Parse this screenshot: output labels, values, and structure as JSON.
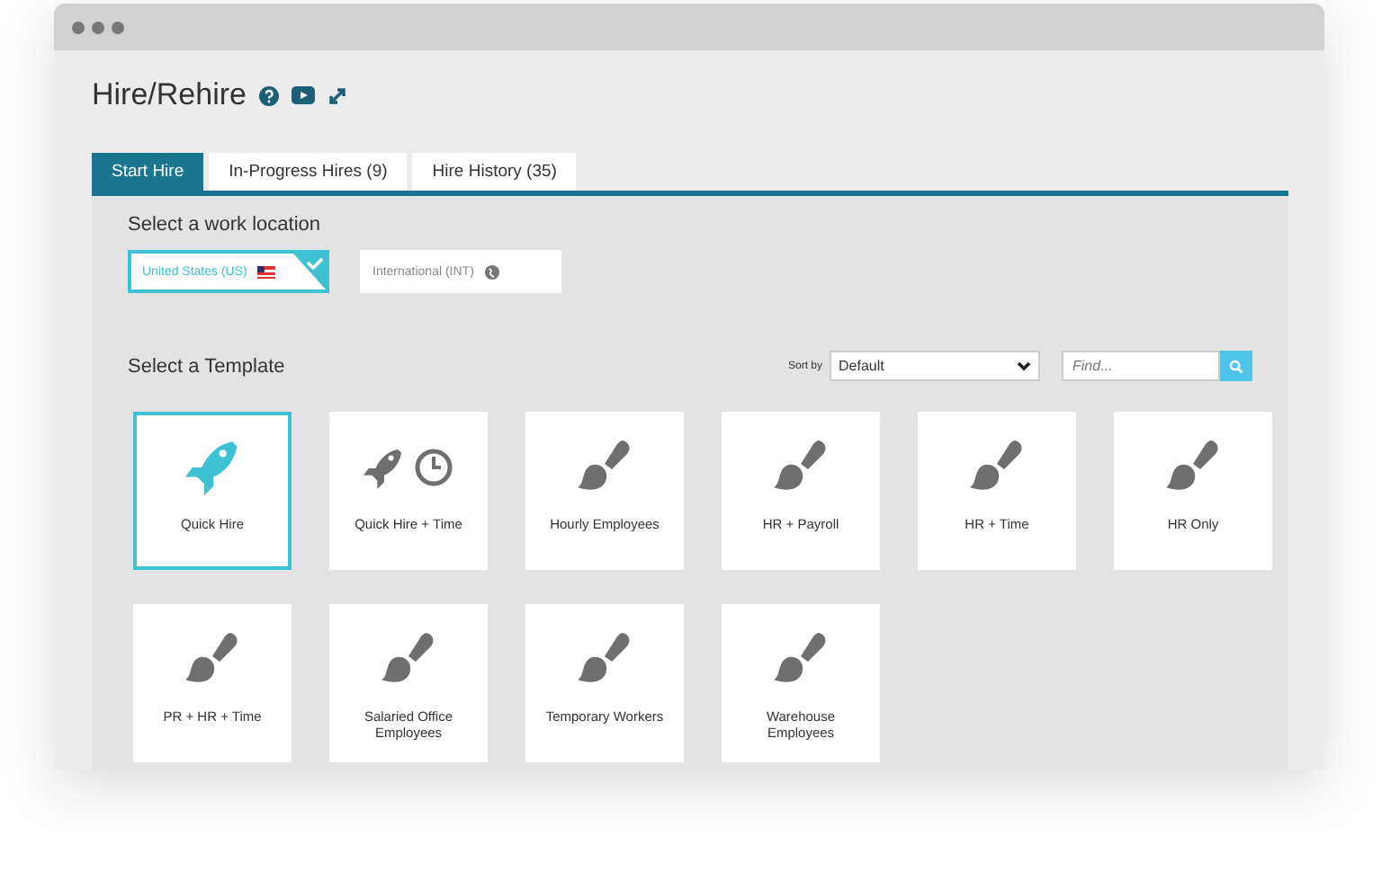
{
  "page": {
    "title": "Hire/Rehire"
  },
  "tabs": [
    {
      "label": "Start Hire",
      "selected": true
    },
    {
      "label": "In-Progress Hires (9)",
      "selected": false
    },
    {
      "label": "Hire History (35)",
      "selected": false
    }
  ],
  "work_location": {
    "heading": "Select a work location",
    "options": [
      {
        "label": "United States (US)",
        "kind": "flag",
        "selected": true
      },
      {
        "label": "International (INT)",
        "kind": "globe",
        "selected": false
      }
    ]
  },
  "templates": {
    "heading": "Select a Template",
    "sort_label": "Sort by",
    "sort_value": "Default",
    "find_placeholder": "Find...",
    "items": [
      {
        "label": "Quick Hire",
        "kind": "rocket",
        "selected": true
      },
      {
        "label": "Quick Hire + Time",
        "kind": "rocket-clock",
        "selected": false
      },
      {
        "label": "Hourly Employees",
        "kind": "brush",
        "selected": false
      },
      {
        "label": "HR + Payroll",
        "kind": "brush",
        "selected": false
      },
      {
        "label": "HR + Time",
        "kind": "brush",
        "selected": false
      },
      {
        "label": "HR Only",
        "kind": "brush",
        "selected": false
      },
      {
        "label": "PR + HR + Time",
        "kind": "brush",
        "selected": false
      },
      {
        "label": "Salaried Office Employees",
        "kind": "brush",
        "selected": false
      },
      {
        "label": "Temporary Workers",
        "kind": "brush",
        "selected": false
      },
      {
        "label": "Warehouse Employees",
        "kind": "brush",
        "selected": false
      }
    ]
  }
}
